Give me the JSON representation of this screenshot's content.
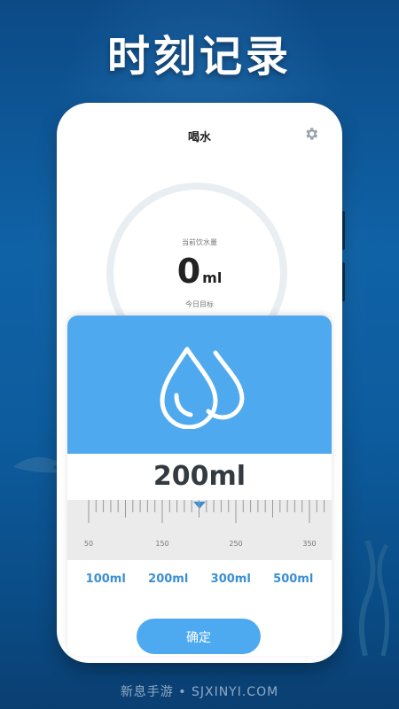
{
  "headline": "时刻记录",
  "app": {
    "title": "喝水",
    "current_label": "当前饮水量",
    "current_value": "0",
    "current_unit": "ml",
    "goal_label": "今日目标"
  },
  "sheet": {
    "amount": "200ml",
    "ruler_labels": [
      "50",
      "150",
      "250",
      "350"
    ],
    "presets": [
      "100ml",
      "200ml",
      "300ml",
      "500ml"
    ],
    "confirm_label": "确定"
  },
  "watermark": "新息手游 • SJXINYI.COM",
  "colors": {
    "accent": "#4ea9ef",
    "preset_text": "#3a8fd4",
    "ruler_bg": "#ebebeb"
  }
}
